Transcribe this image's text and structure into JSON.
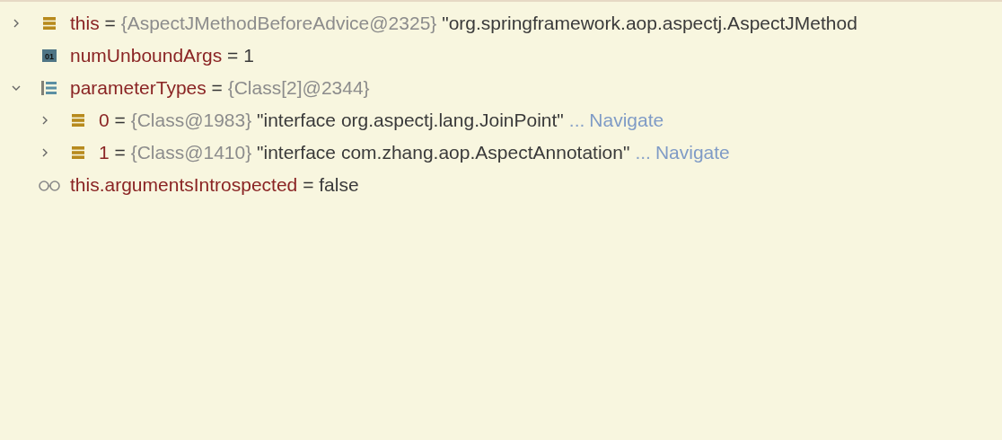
{
  "variables": [
    {
      "kind": "object",
      "expanded": false,
      "name": "this",
      "separator": "=",
      "type_ref": "{AspectJMethodBeforeAdvice@2325}",
      "value": "\"org.springframework.aop.aspectj.AspectJMethod"
    },
    {
      "kind": "primitive",
      "icon_text": "01",
      "name": "numUnboundArgs",
      "separator": "=",
      "value": "1"
    },
    {
      "kind": "array",
      "expanded": true,
      "name": "parameterTypes",
      "separator": "=",
      "type_ref": "{Class[2]@2344}",
      "children": [
        {
          "kind": "object",
          "expanded": false,
          "name": "0",
          "separator": "=",
          "type_ref": "{Class@1983}",
          "value": "\"interface org.aspectj.lang.JoinPoint\"",
          "ellipsis": "...",
          "link": "Navigate"
        },
        {
          "kind": "object",
          "expanded": false,
          "name": "1",
          "separator": "=",
          "type_ref": "{Class@1410}",
          "value": "\"interface com.zhang.aop.AspectAnnotation\"",
          "ellipsis": "...",
          "link": "Navigate"
        }
      ]
    },
    {
      "kind": "watch",
      "name": "this.argumentsIntrospected",
      "separator": "=",
      "value": "false"
    }
  ]
}
